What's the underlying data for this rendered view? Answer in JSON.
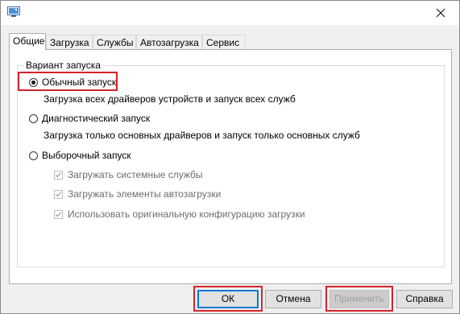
{
  "tabs": [
    {
      "label": "Общие",
      "active": true
    },
    {
      "label": "Загрузка",
      "active": false
    },
    {
      "label": "Службы",
      "active": false
    },
    {
      "label": "Автозагрузка",
      "active": false
    },
    {
      "label": "Сервис",
      "active": false
    }
  ],
  "group": {
    "label": "Вариант запуска",
    "options": [
      {
        "label": "Обычный запуск",
        "selected": true,
        "description": "Загрузка всех драйверов устройств и запуск всех служб"
      },
      {
        "label": "Диагностический запуск",
        "selected": false,
        "description": "Загрузка только основных драйверов и запуск только основных служб"
      },
      {
        "label": "Выборочный запуск",
        "selected": false,
        "description": ""
      }
    ],
    "checkboxes": [
      {
        "label": "Загружать системные службы",
        "checked": true,
        "enabled": false
      },
      {
        "label": "Загружать элементы автозагрузки",
        "checked": true,
        "enabled": false
      },
      {
        "label": "Использовать оригинальную конфигурацию загрузки",
        "checked": true,
        "enabled": false
      }
    ]
  },
  "buttons": {
    "ok": "ОК",
    "cancel": "Отмена",
    "apply": "Применить",
    "help": "Справка"
  },
  "colors": {
    "highlight": "#d6232a",
    "accent": "#0078d7"
  },
  "icons": {
    "app": "msconfig-icon",
    "close": "close-icon"
  }
}
